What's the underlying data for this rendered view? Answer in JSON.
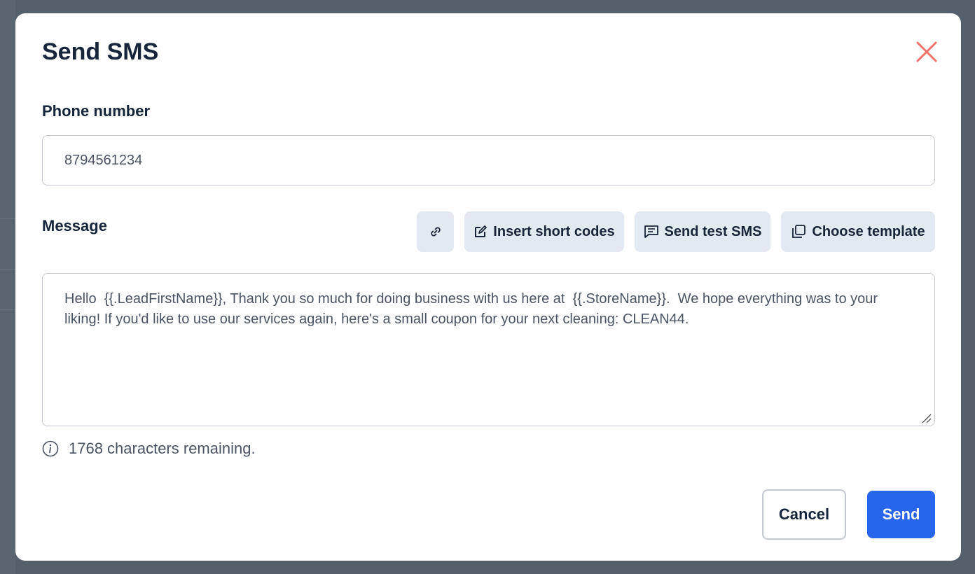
{
  "modal": {
    "title": "Send SMS",
    "phone_label": "Phone number",
    "phone_value": "8794561234",
    "message_label": "Message",
    "toolbar": {
      "link_icon": "link-icon",
      "insert_short_codes": "Insert short codes",
      "send_test_sms": "Send test SMS",
      "choose_template": "Choose template"
    },
    "message_value": "Hello  {{.LeadFirstName}}, Thank you so much for doing business with us here at  {{.StoreName}}.  We hope everything was to your liking! If you'd like to use our services again, here's a small coupon for your next cleaning: CLEAN44.",
    "characters_remaining": "1768 characters remaining.",
    "cancel_label": "Cancel",
    "send_label": "Send"
  },
  "colors": {
    "primary": "#2765ec",
    "close_icon": "#f0736a",
    "heading_text": "#17243a",
    "tool_button_bg": "#e3e9f0"
  }
}
